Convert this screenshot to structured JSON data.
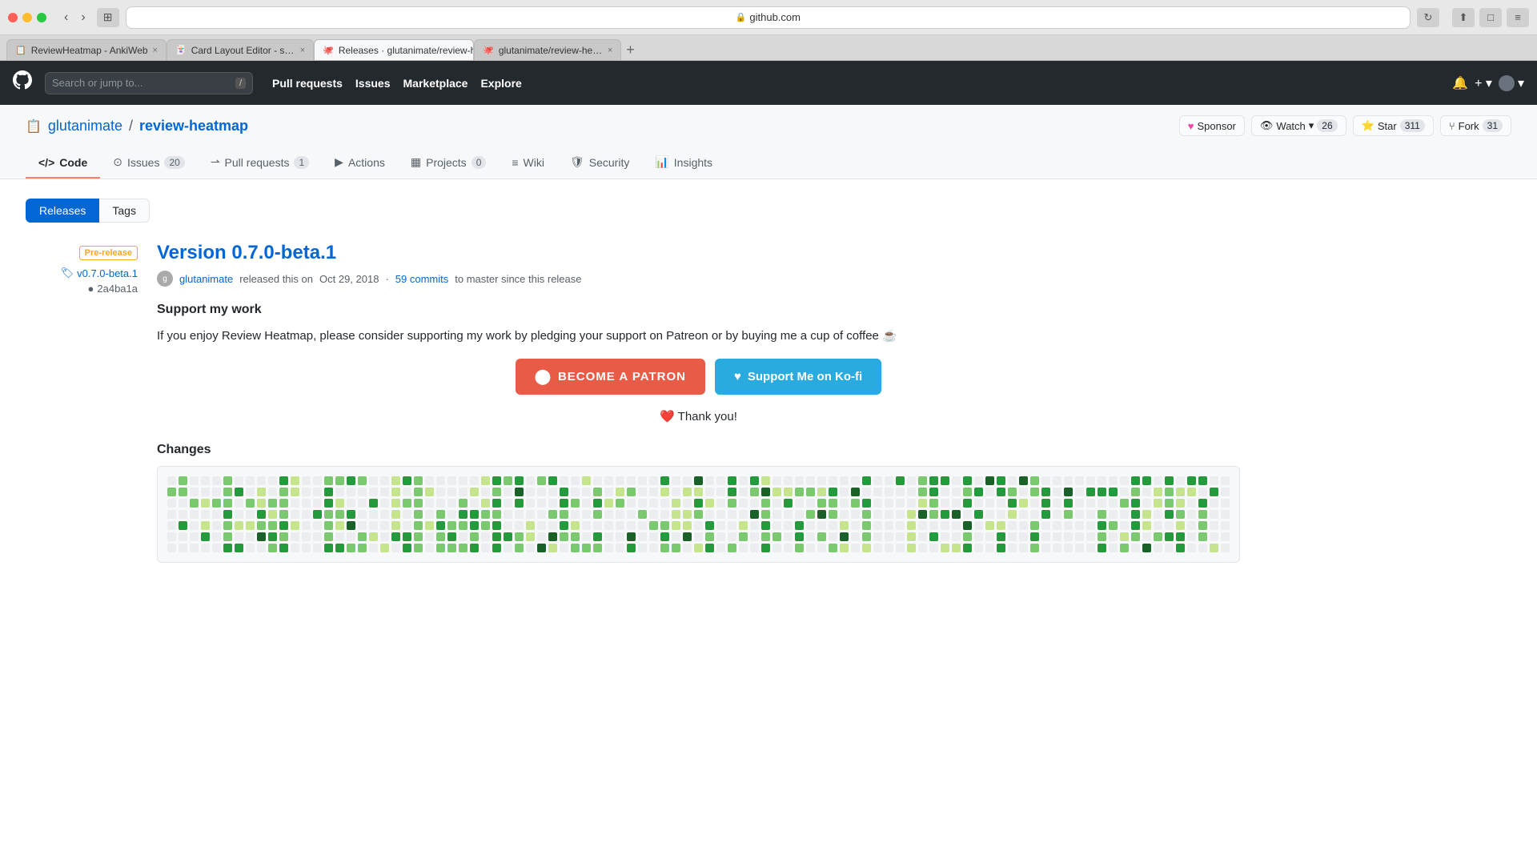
{
  "browser": {
    "url": "github.com",
    "url_display": "github.com",
    "tabs": [
      {
        "id": "tab1",
        "favicon": "📋",
        "title": "ReviewHeatmap - AnkiWeb",
        "active": false
      },
      {
        "id": "tab2",
        "favicon": "🃏",
        "title": "Card Layout Editor - syntax highlighting, monospace font...",
        "active": false
      },
      {
        "id": "tab3",
        "favicon": "🐙",
        "title": "Releases · glutanimate/review-heatmap",
        "active": true
      },
      {
        "id": "tab4",
        "favicon": "🐙",
        "title": "glutanimate/review-heatmap: Anki add-on to help you...",
        "active": false
      }
    ]
  },
  "github": {
    "nav": {
      "search_placeholder": "Search or jump to...",
      "search_shortcut": "/",
      "items": [
        "Pull requests",
        "Issues",
        "Marketplace",
        "Explore"
      ]
    },
    "repo": {
      "icon": "📋",
      "owner": "glutanimate",
      "name": "review-heatmap",
      "buttons": {
        "sponsor": "Sponsor",
        "watch": "Watch",
        "watch_count": "26",
        "star": "Star",
        "star_count": "311",
        "fork": "Fork",
        "fork_count": "31"
      },
      "nav_items": [
        {
          "label": "Code",
          "icon": "◻",
          "active": true,
          "badge": null
        },
        {
          "label": "Issues",
          "icon": "⊙",
          "active": false,
          "badge": "20"
        },
        {
          "label": "Pull requests",
          "icon": "⇀",
          "active": false,
          "badge": "1"
        },
        {
          "label": "Actions",
          "icon": "▶",
          "active": false,
          "badge": null
        },
        {
          "label": "Projects",
          "icon": "▦",
          "active": false,
          "badge": "0"
        },
        {
          "label": "Wiki",
          "icon": "≡",
          "active": false,
          "badge": null
        },
        {
          "label": "Security",
          "icon": "🛡",
          "active": false,
          "badge": null
        },
        {
          "label": "Insights",
          "icon": "📊",
          "active": false,
          "badge": null
        }
      ]
    }
  },
  "releases_page": {
    "title": "Releases",
    "tabs": [
      {
        "label": "Releases",
        "active": true
      },
      {
        "label": "Tags",
        "active": false
      }
    ],
    "release": {
      "pre_release_badge": "Pre-release",
      "tag": "v0.7.0-beta.1",
      "commit": "2a4ba1a",
      "title": "Version 0.7.0-beta.1",
      "author": "glutanimate",
      "date": "Oct 29, 2018",
      "commits_link": "59 commits",
      "commits_text": "to master since this release",
      "body": {
        "heading": "Support my work",
        "paragraph": "If you enjoy Review Heatmap, please consider supporting my work by pledging your support on Patreon or by buying me a cup of coffee ☕",
        "patreon_btn": "BECOME A PATRON",
        "kofi_btn": "Support Me on Ko-fi",
        "thankyou": "❤️ Thank you!",
        "changes_heading": "Changes"
      }
    }
  }
}
